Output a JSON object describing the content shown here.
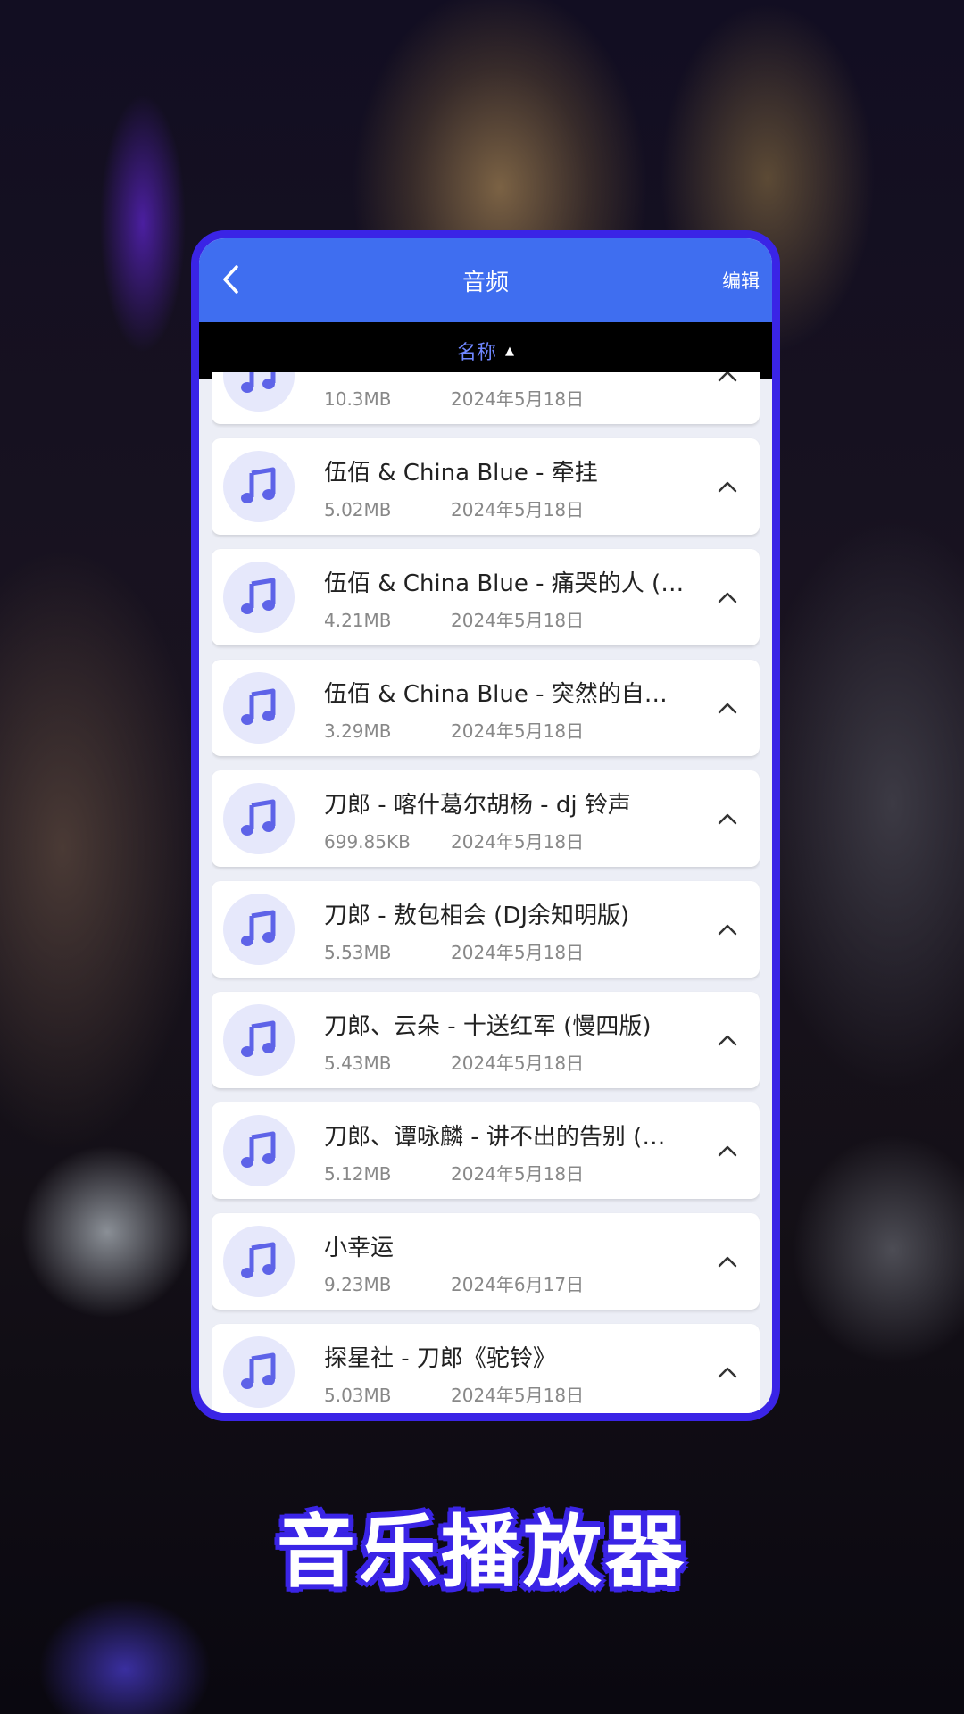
{
  "header": {
    "title": "音频",
    "edit_label": "编辑"
  },
  "sort": {
    "label": "名称",
    "arrow": "▲"
  },
  "files": [
    {
      "name": "",
      "size": "10.3MB",
      "date": "2024年5月18日"
    },
    {
      "name": "伍佰 & China Blue - 牵挂",
      "size": "5.02MB",
      "date": "2024年5月18日"
    },
    {
      "name": "伍佰 & China Blue - 痛哭的人 (…",
      "size": "4.21MB",
      "date": "2024年5月18日"
    },
    {
      "name": "伍佰 & China Blue - 突然的自…",
      "size": "3.29MB",
      "date": "2024年5月18日"
    },
    {
      "name": "刀郎 - 喀什葛尔胡杨 - dj 铃声",
      "size": "699.85KB",
      "date": "2024年5月18日"
    },
    {
      "name": "刀郎 - 敖包相会 (DJ余知明版)",
      "size": "5.53MB",
      "date": "2024年5月18日"
    },
    {
      "name": "刀郎、云朵 - 十送红军 (慢四版)",
      "size": "5.43MB",
      "date": "2024年5月18日"
    },
    {
      "name": "刀郎、谭咏麟 - 讲不出的告别 (…",
      "size": "5.12MB",
      "date": "2024年5月18日"
    },
    {
      "name": "小幸运",
      "size": "9.23MB",
      "date": "2024年6月17日"
    },
    {
      "name": "探星社 - 刀郎《驼铃》",
      "size": "5.03MB",
      "date": "2024年5月18日"
    }
  ],
  "caption": "音乐播放器",
  "colors": {
    "appbar": "#3f6ef0",
    "frame": "#3a24e6",
    "icon_note": "#5e63e8",
    "icon_bg": "#e6e8fb"
  }
}
